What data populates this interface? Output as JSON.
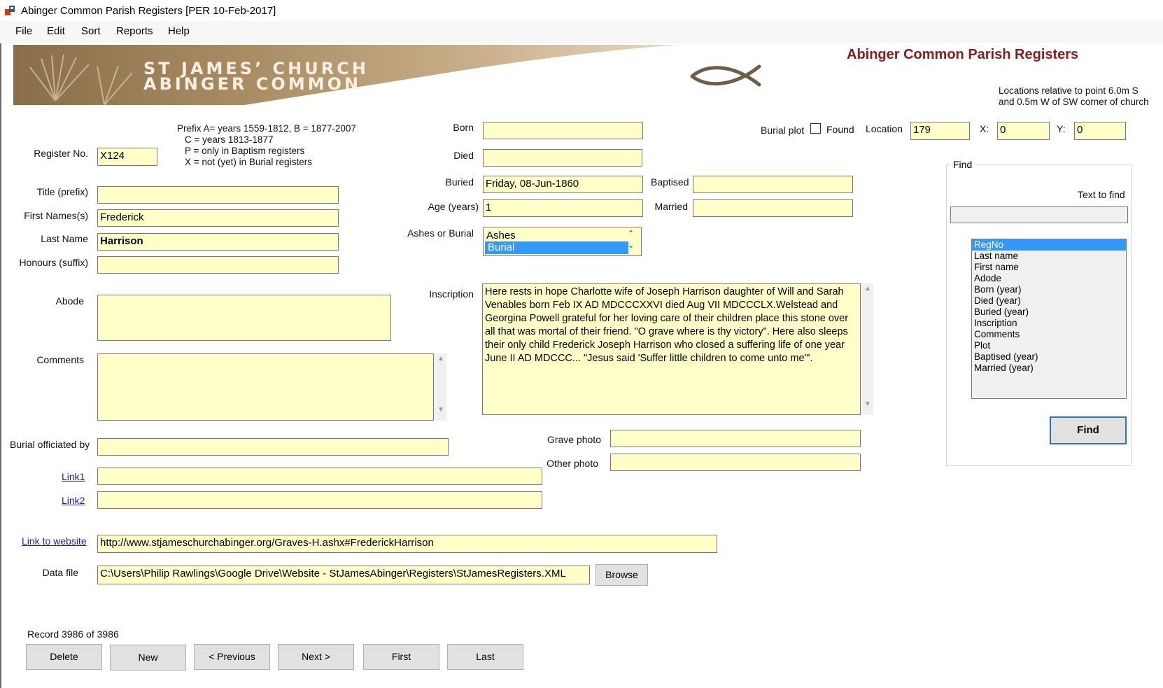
{
  "window": {
    "title": "Abinger Common Parish Registers [PER 10-Feb-2017]"
  },
  "menu": [
    "File",
    "Edit",
    "Sort",
    "Reports",
    "Help"
  ],
  "banner": {
    "line1": "ST JAMES’ CHURCH",
    "line2": "ABINGER COMMON"
  },
  "app_heading": "Abinger Common Parish Registers",
  "location_note": [
    "Locations relative to point 6.0m S",
    "and 0.5m W of SW corner of church"
  ],
  "prefix_note": [
    "Prefix A= years 1559-1812, B = 1877-2007",
    "C = years 1813-1877",
    "P = only in Baptism registers",
    "X = not (yet) in Burial registers"
  ],
  "labels": {
    "register_no": "Register No.",
    "title": "Title (prefix)",
    "first_names": "First Names(s)",
    "last_name": "Last Name",
    "honours": "Honours (suffix)",
    "abode": "Abode",
    "comments": "Comments",
    "burial_officiated": "Burial officiated by",
    "born": "Born",
    "died": "Died",
    "buried": "Buried",
    "age": "Age (years)",
    "ashes_or_burial": "Ashes or Burial",
    "baptised": "Baptised",
    "married": "Married",
    "inscription": "Inscription",
    "grave_photo": "Grave photo",
    "other_photo": "Other photo",
    "burial_plot": "Burial plot",
    "found": "Found",
    "location": "Location",
    "x": "X:",
    "y": "Y:",
    "data_file": "Data file"
  },
  "links": {
    "link1": "Link1",
    "link2": "Link2",
    "website": "Link to website"
  },
  "values": {
    "register_no": "X124",
    "title": "",
    "first_names": "Frederick",
    "last_name": "Harrison",
    "honours": "",
    "abode": "",
    "comments": "",
    "burial_officiated": "",
    "born": "",
    "died": "",
    "buried": "Friday, 08-Jun-1860",
    "age": "1",
    "baptised": "",
    "married": "",
    "inscription": "Here rests in hope Charlotte wife of Joseph Harrison daughter of Will and Sarah Venables born Feb IX AD MDCCCXXVI died Aug VII MDCCCLX.Welstead and Georgina Powell grateful for her loving care of their children place this stone over all that was mortal of their friend. \"O grave where is thy victory\". Here also sleeps their only child Frederick Joseph Harrison who closed a suffering life of one year June II AD MDCCC... \"Jesus said 'Suffer little children to come unto me'\".",
    "grave_photo": "",
    "other_photo": "",
    "location": "179",
    "x": "0",
    "y": "0",
    "found": false,
    "link1": "",
    "link2": "",
    "website": "http://www.stjameschurchabinger.org/Graves-H.ashx#FrederickHarrison",
    "data_file": "C:\\Users\\Philip Rawlings\\Google Drive\\Website - StJamesAbinger\\Registers\\StJamesRegisters.XML"
  },
  "ashes_burial_options": [
    "Ashes",
    "Burial"
  ],
  "ashes_burial_selected": "Burial",
  "find": {
    "legend": "Find",
    "text_label": "Text to find",
    "text_value": "",
    "fields": [
      "RegNo",
      "Last name",
      "First name",
      "Adode",
      "Born (year)",
      "Died (year)",
      "Buried  (year)",
      "Inscription",
      "Comments",
      "Plot",
      "Baptised (year)",
      "Married (year)"
    ],
    "selected": "RegNo",
    "button": "Find"
  },
  "browse_button": "Browse",
  "record_status": "Record 3986 of 3986",
  "nav": {
    "delete": "Delete",
    "new": "New",
    "previous": "< Previous",
    "next": "Next >",
    "first": "First",
    "last": "Last"
  }
}
